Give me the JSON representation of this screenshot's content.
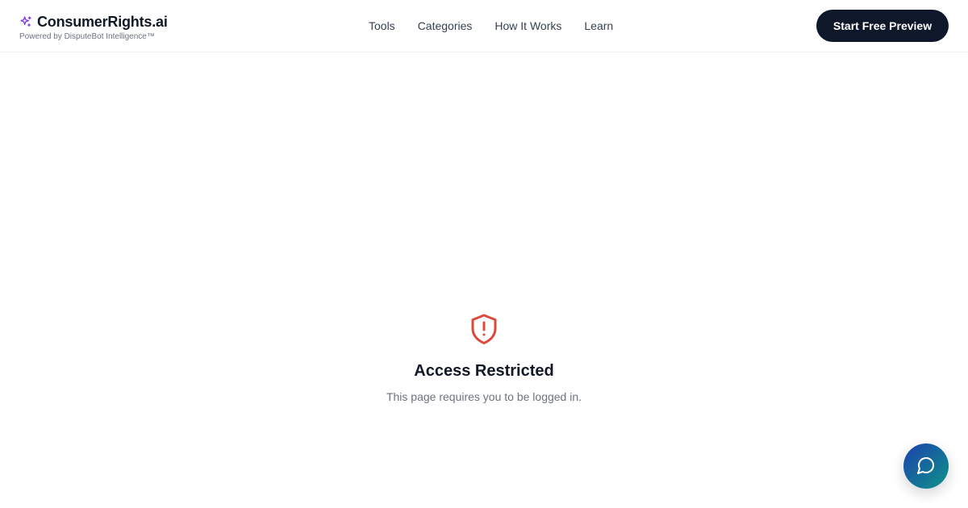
{
  "brand": {
    "name": "ConsumerRights.ai",
    "tagline": "Powered by DisputeBot Intelligence™",
    "icon": "sparkles-icon",
    "icon_color": "#7c3aed"
  },
  "nav": {
    "items": [
      {
        "label": "Tools"
      },
      {
        "label": "Categories"
      },
      {
        "label": "How It Works"
      },
      {
        "label": "Learn"
      }
    ]
  },
  "header": {
    "cta_label": "Start Free Preview",
    "cta_color": "#0f172a"
  },
  "main": {
    "icon": "shield-alert-icon",
    "icon_color": "#dc4a3d",
    "title": "Access Restricted",
    "message": "This page requires you to be logged in."
  },
  "chat": {
    "icon": "message-circle-icon",
    "gradient_start": "#1e40af",
    "gradient_end": "#0d9488"
  }
}
